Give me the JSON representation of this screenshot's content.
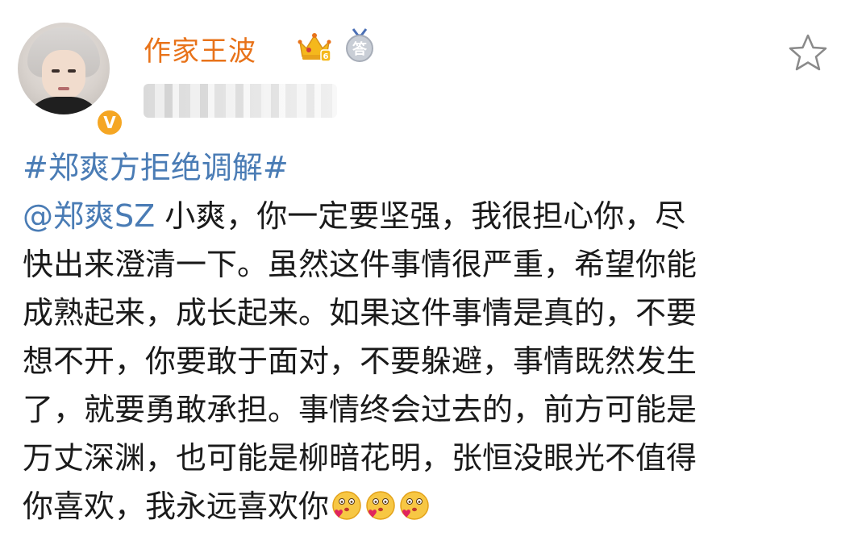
{
  "author": {
    "name": "作家王波",
    "verified_mark": "V",
    "badges": [
      "crown-icon",
      "answer-icon"
    ],
    "answer_badge_text": "答",
    "crown_level": "6"
  },
  "actions": {
    "favorite_icon": "star-icon"
  },
  "post": {
    "hashtag": "#郑爽方拒绝调解#",
    "mention": "@郑爽SZ",
    "lines": [
      " 小爽，你一定要坚强，我很担心你，尽",
      "快出来澄清一下。虽然这件事情很严重，希望你能",
      "成熟起来，成长起来。如果这件事情是真的，不要",
      "想不开，你要敢于面对，不要躲避，事情既然发生",
      "了，就要勇敢承担。事情终会过去的，前方可能是",
      "万丈深渊，也可能是柳暗花明，张恒没眼光不值得",
      "你喜欢，我永远喜欢你"
    ],
    "trailing_emoji": [
      "kiss-heart-emoji",
      "kiss-heart-emoji",
      "kiss-heart-emoji"
    ]
  },
  "colors": {
    "username": "#e8731a",
    "link": "#4a7cb5",
    "verified": "#f5a623"
  }
}
